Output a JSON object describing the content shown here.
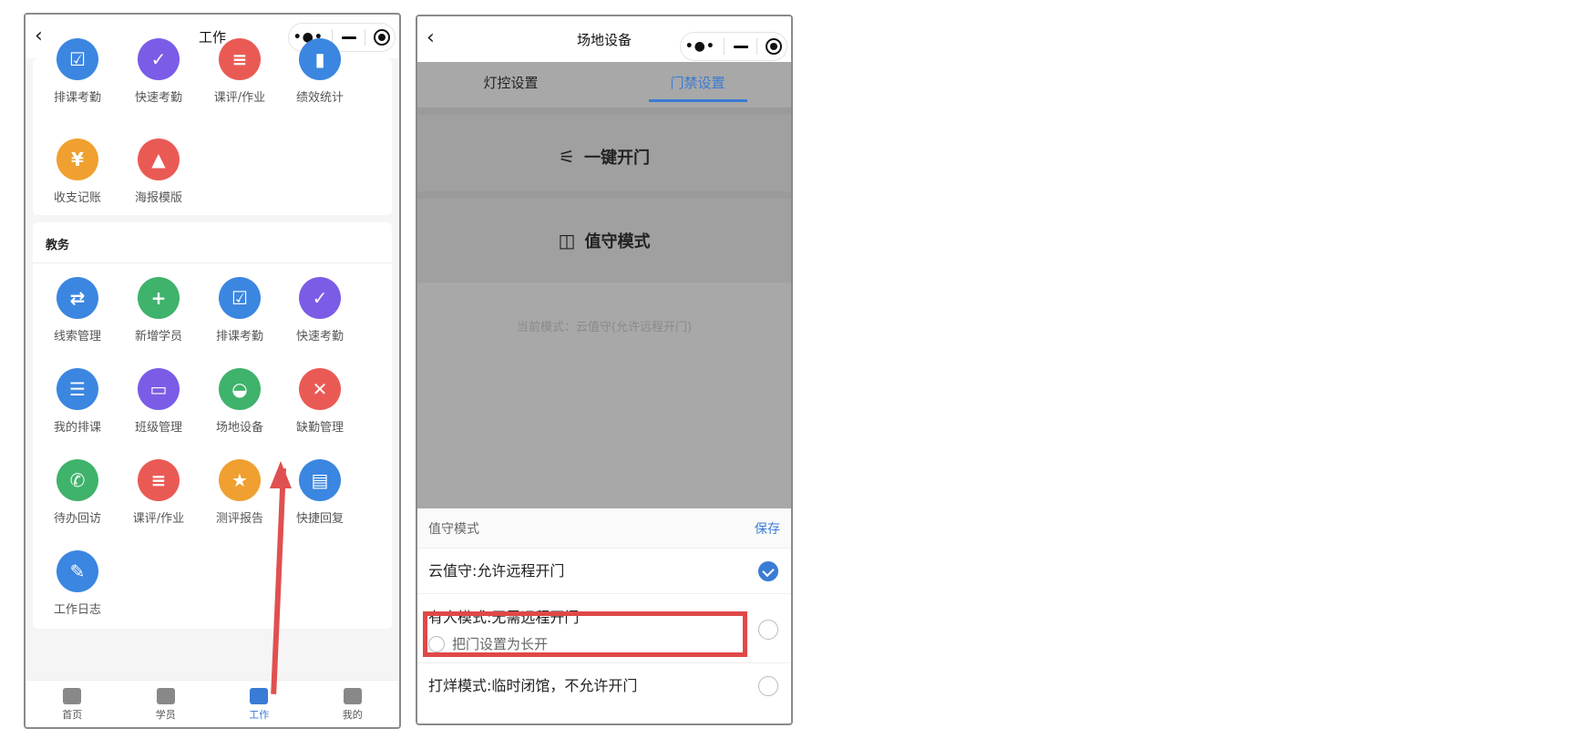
{
  "left": {
    "nav": {
      "back": "‹",
      "title": "工作"
    },
    "capsule": {
      "dots": "•●•"
    },
    "top_row": [
      {
        "label": "排课考勤",
        "color": "#3b86e0",
        "icon": "schedule-icon",
        "glyph": "☑"
      },
      {
        "label": "快速考勤",
        "color": "#7b5ce6",
        "icon": "check-icon",
        "glyph": "✓"
      },
      {
        "label": "课评/作业",
        "color": "#ea5a55",
        "icon": "list-icon",
        "glyph": "≡"
      },
      {
        "label": "绩效统计",
        "color": "#3b86e0",
        "icon": "bar-chart-icon",
        "glyph": "▮"
      }
    ],
    "second_row": [
      {
        "label": "收支记账",
        "color": "#f0a030",
        "icon": "yen-icon",
        "glyph": "¥"
      },
      {
        "label": "海报模版",
        "color": "#ea5a55",
        "icon": "mountain-icon",
        "glyph": "▲"
      }
    ],
    "section_title": "教务",
    "edu_rows": [
      [
        {
          "label": "线索管理",
          "color": "#3b86e0",
          "icon": "clue-icon",
          "glyph": "⇄"
        },
        {
          "label": "新增学员",
          "color": "#3fb26b",
          "icon": "add-user-icon",
          "glyph": "+"
        },
        {
          "label": "排课考勤",
          "color": "#3b86e0",
          "icon": "schedule-icon",
          "glyph": "☑"
        },
        {
          "label": "快速考勤",
          "color": "#7b5ce6",
          "icon": "check-icon",
          "glyph": "✓"
        }
      ],
      [
        {
          "label": "我的排课",
          "color": "#3b86e0",
          "icon": "calendar-icon",
          "glyph": "☰"
        },
        {
          "label": "班级管理",
          "color": "#7b5ce6",
          "icon": "class-icon",
          "glyph": "▭"
        },
        {
          "label": "场地设备",
          "color": "#3fb26b",
          "icon": "lamp-icon",
          "glyph": "◒"
        },
        {
          "label": "缺勤管理",
          "color": "#ea5a55",
          "icon": "absence-icon",
          "glyph": "✕"
        }
      ],
      [
        {
          "label": "待办回访",
          "color": "#3fb26b",
          "icon": "phone-icon",
          "glyph": "✆"
        },
        {
          "label": "课评/作业",
          "color": "#ea5a55",
          "icon": "list-icon",
          "glyph": "≡"
        },
        {
          "label": "测评报告",
          "color": "#f0a030",
          "icon": "report-icon",
          "glyph": "★"
        },
        {
          "label": "快捷回复",
          "color": "#3b86e0",
          "icon": "reply-icon",
          "glyph": "▤"
        }
      ],
      [
        {
          "label": "工作日志",
          "color": "#3b86e0",
          "icon": "pen-icon",
          "glyph": "✎"
        }
      ]
    ],
    "tabbar": [
      {
        "label": "首页",
        "icon": "home-icon",
        "active": false
      },
      {
        "label": "学员",
        "icon": "students-icon",
        "active": false
      },
      {
        "label": "工作",
        "icon": "work-icon",
        "active": true
      },
      {
        "label": "我的",
        "icon": "profile-icon",
        "active": false
      }
    ]
  },
  "right": {
    "nav": {
      "back": "‹",
      "title": "场地设备"
    },
    "capsule": {
      "dots": "•●•"
    },
    "tabs": [
      {
        "label": "灯控设置",
        "active": false
      },
      {
        "label": "门禁设置",
        "active": true
      }
    ],
    "open_door": {
      "label": "一键开门",
      "icon": "door-sensor-icon",
      "glyph": "⚟"
    },
    "guard_mode": {
      "label": "值守模式",
      "icon": "door-icon",
      "glyph": "◫"
    },
    "current_mode": "当前模式：云值守(允许远程开门)",
    "sheet": {
      "title": "值守模式",
      "save": "保存",
      "options": [
        {
          "label": "云值守:允许远程开门",
          "checked": true
        },
        {
          "label": "有人模式:无需远程开门",
          "checked": false,
          "sub": "把门设置为长开"
        },
        {
          "label": "打烊模式:临时闭馆，不允许开门",
          "checked": false
        }
      ]
    }
  }
}
